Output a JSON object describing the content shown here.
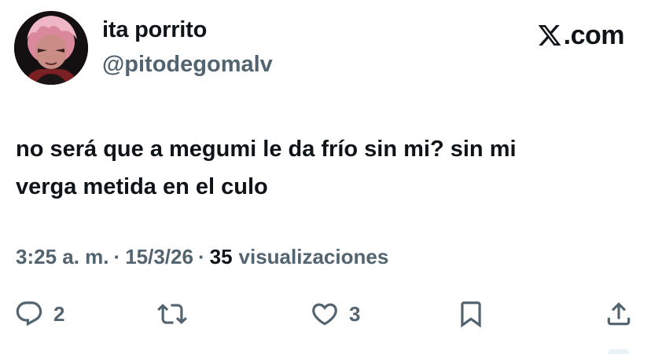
{
  "brand": {
    "name": "X.com",
    "logo_icon": "x-logo-icon",
    "text": ".com"
  },
  "author": {
    "display_name": "ita porrito",
    "handle": "@pitodegomalv",
    "avatar_icon": "avatar-anime-character"
  },
  "tweet": {
    "text": "no será que a megumi le da frío sin mi? sin mi\nverga metida en el culo"
  },
  "meta": {
    "time": "3:25 a. m.",
    "separator": "·",
    "date": "15/3/26",
    "views_count": "35",
    "views_label": "visualizaciones"
  },
  "actions": {
    "reply": {
      "icon": "reply-icon",
      "count": "2"
    },
    "retweet": {
      "icon": "retweet-icon",
      "count": ""
    },
    "like": {
      "icon": "heart-icon",
      "count": "3"
    },
    "bookmark": {
      "icon": "bookmark-icon"
    },
    "share": {
      "icon": "share-icon"
    }
  },
  "colors": {
    "text_primary": "#0f1419",
    "text_secondary": "#536471",
    "background": "#ffffff"
  }
}
